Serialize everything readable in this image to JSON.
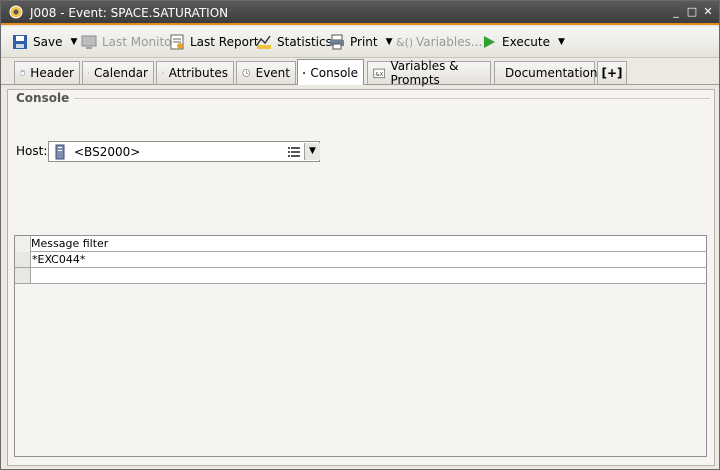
{
  "window": {
    "title": "J008 - Event: SPACE.SATURATION",
    "buttons": [
      "_",
      "□",
      "✕"
    ]
  },
  "toolbar": {
    "save_label": "Save",
    "last_monitor_label": "Last Monitor",
    "last_report_label": "Last Report",
    "statistics_label": "Statistics",
    "print_label": "Print",
    "variables_label": "Variables...",
    "execute_label": "Execute"
  },
  "tabs": [
    {
      "label": "Header"
    },
    {
      "label": "Calendar"
    },
    {
      "label": "Attributes"
    },
    {
      "label": "Event"
    },
    {
      "label": "Console"
    },
    {
      "label": "Variables & Prompts"
    },
    {
      "label": "Documentation"
    },
    {
      "label": "[+]"
    }
  ],
  "console": {
    "section_title": "Console",
    "host_label": "Host:",
    "host_value": "<BS2000>",
    "grid": {
      "column_header": "Message filter",
      "rows": [
        "*EXC044*",
        ""
      ]
    }
  },
  "colors": {
    "titlebar": "#4a4a4a",
    "title_accent": "#e08a1e",
    "execute_green": "#2ea12e"
  }
}
